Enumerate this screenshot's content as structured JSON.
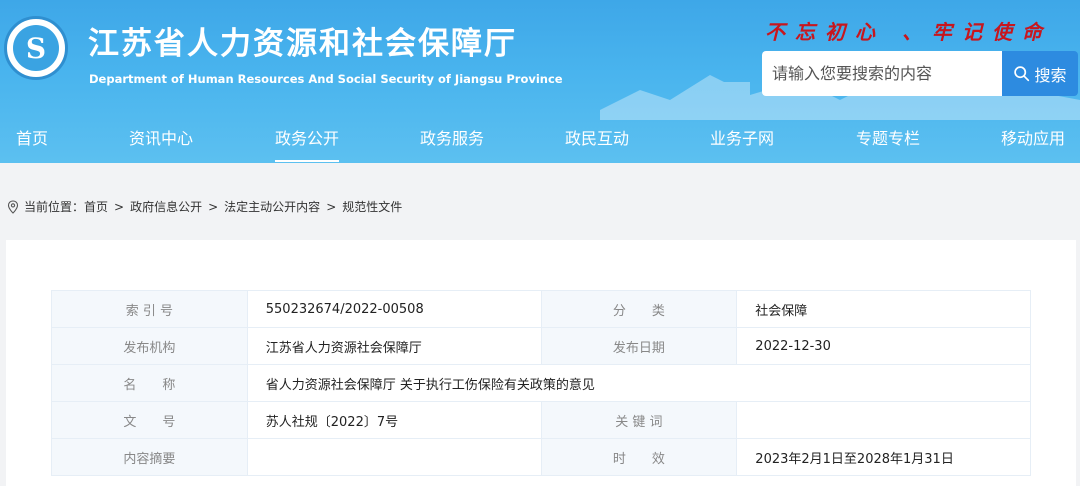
{
  "header": {
    "title": "江苏省人力资源和社会保障厅",
    "subtitle": "Department of Human Resources And Social Security of Jiangsu Province",
    "slogan": "不忘初心 、牢记使命"
  },
  "search": {
    "placeholder": "请输入您要搜索的内容",
    "button_label": "搜索"
  },
  "nav": {
    "items": [
      {
        "label": "首页"
      },
      {
        "label": "资讯中心"
      },
      {
        "label": "政务公开"
      },
      {
        "label": "政务服务"
      },
      {
        "label": "政民互动"
      },
      {
        "label": "业务子网"
      },
      {
        "label": "专题专栏"
      },
      {
        "label": "移动应用"
      }
    ],
    "active": "政务公开"
  },
  "breadcrumb": {
    "prefix": "当前位置：",
    "items": [
      "首页",
      "政府信息公开",
      "法定主动公开内容",
      "规范性文件"
    ],
    "separator": ">"
  },
  "meta": {
    "rows": [
      {
        "l1": "索 引 号",
        "v1": "550232674/2022-00508",
        "l2": "分　　类",
        "v2": "社会保障"
      },
      {
        "l1": "发布机构",
        "v1": "江苏省人力资源社会保障厅",
        "l2": "发布日期",
        "v2": "2022-12-30"
      },
      {
        "l1": "名　　称",
        "v1": "省人力资源社会保障厅 关于执行工伤保险有关政策的意见"
      },
      {
        "l1": "文　　号",
        "v1": "苏人社规〔2022〕7号",
        "l2": "关 键 词",
        "v2": ""
      },
      {
        "l1": "内容摘要",
        "v1": "",
        "l2": "时　　效",
        "v2": "2023年2月1日至2028年1月31日"
      }
    ]
  }
}
